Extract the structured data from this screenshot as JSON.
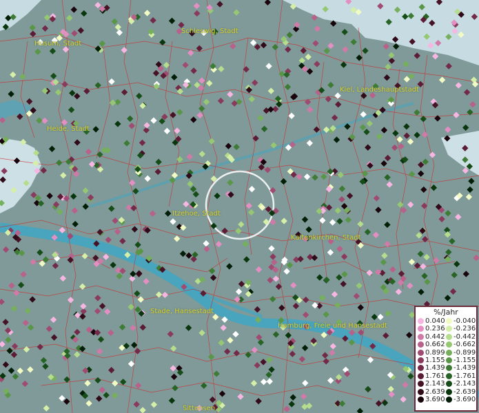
{
  "cities": [
    {
      "name": "Schleswig, Stadt"
    },
    {
      "name": "Husum, Stadt"
    },
    {
      "name": "Kiel, Landeshauptstadt"
    },
    {
      "name": "Heide, Stadt"
    },
    {
      "name": "Itzehoe, Stadt"
    },
    {
      "name": "Kaltenkirchen, Stadt"
    },
    {
      "name": "Stade, Hansestadt"
    },
    {
      "name": "Hamburg, Freie und Hansestadt"
    },
    {
      "name": "Sittensen"
    }
  ],
  "legend": {
    "title": "%/Jahr",
    "positive": [
      {
        "label": "0.040",
        "color": "#f7b6e2"
      },
      {
        "label": "0.236",
        "color": "#e48fc4"
      },
      {
        "label": "0.442",
        "color": "#d07aa8"
      },
      {
        "label": "0.662",
        "color": "#b8618a"
      },
      {
        "label": "0.899",
        "color": "#a04c72"
      },
      {
        "label": "1.155",
        "color": "#8a3a5c"
      },
      {
        "label": "1.439",
        "color": "#732a48"
      },
      {
        "label": "1.761",
        "color": "#5c1c36"
      },
      {
        "label": "2.143",
        "color": "#461226"
      },
      {
        "label": "2.639",
        "color": "#300a18"
      },
      {
        "label": "3.690",
        "color": "#1a040c"
      }
    ],
    "negative": [
      {
        "label": "-0.040",
        "color": "#f2fbc4"
      },
      {
        "label": "-0.236",
        "color": "#d6efa8"
      },
      {
        "label": "-0.442",
        "color": "#b6dd8e"
      },
      {
        "label": "-0.662",
        "color": "#96c874"
      },
      {
        "label": "-0.899",
        "color": "#76b05c"
      },
      {
        "label": "-1.155",
        "color": "#5a9648"
      },
      {
        "label": "-1.439",
        "color": "#3e7c36"
      },
      {
        "label": "-1.761",
        "color": "#286426"
      },
      {
        "label": "-2.143",
        "color": "#164c18"
      },
      {
        "label": "-2.639",
        "color": "#0a360e"
      },
      {
        "label": "-3.690",
        "color": "#031e06"
      }
    ]
  },
  "colors": {
    "land": "#7f9a98",
    "water": "#3fa6c4",
    "border": "#d02828",
    "label": "#d9cf2a",
    "focus_circle": "#ffffff"
  }
}
